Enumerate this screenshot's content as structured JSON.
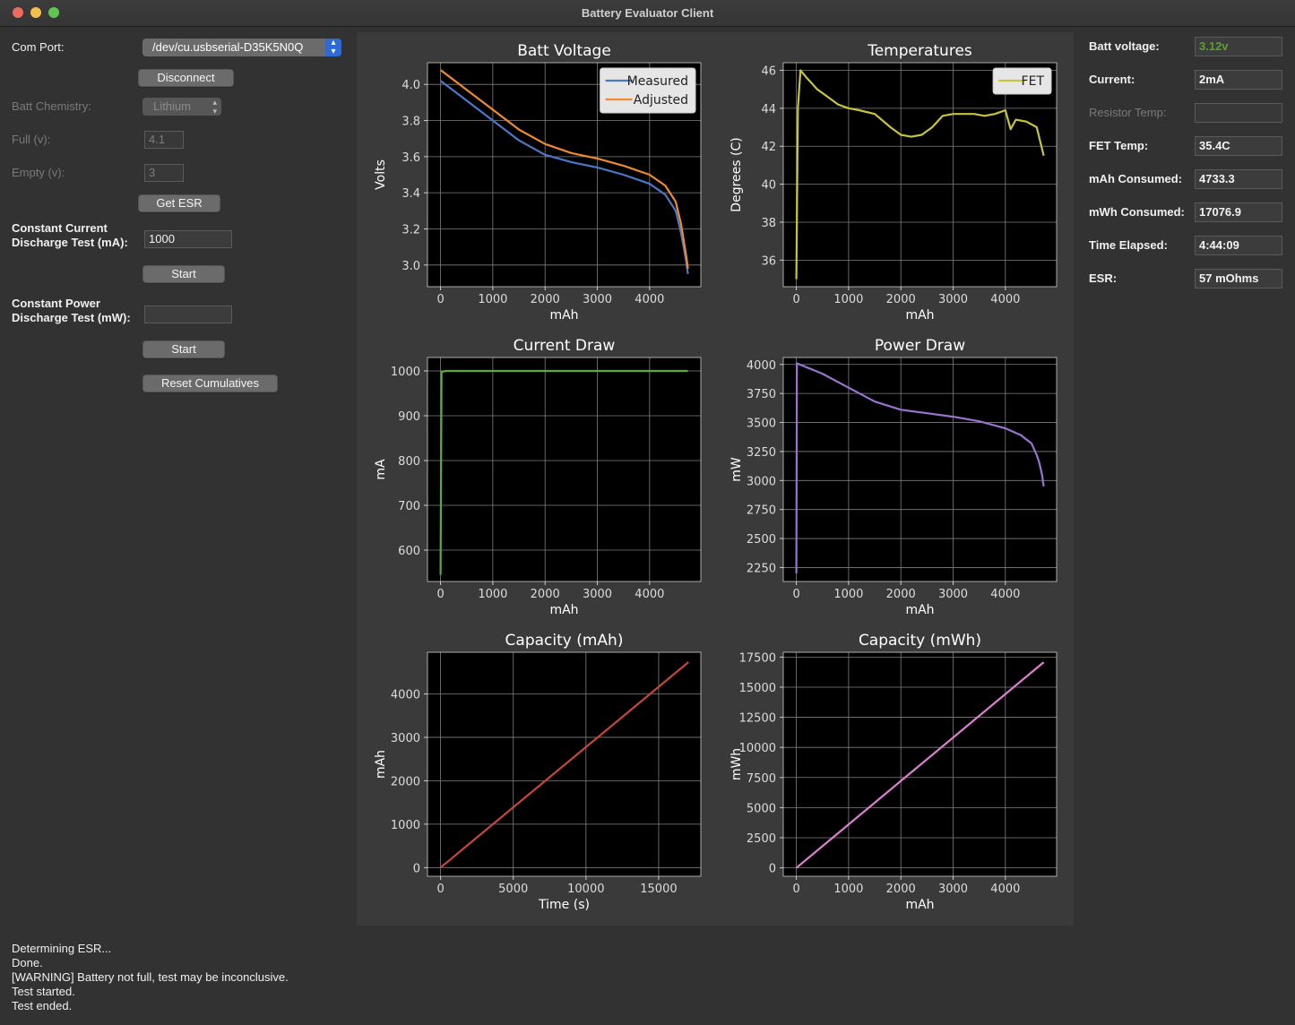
{
  "window": {
    "title": "Battery Evaluator Client"
  },
  "controls": {
    "com_port_label": "Com Port:",
    "com_port_value": "/dev/cu.usbserial-D35K5N0Q",
    "disconnect": "Disconnect",
    "chemistry_label": "Batt Chemistry:",
    "chemistry_value": "Lithium",
    "full_label": "Full (v):",
    "full_value": "4.1",
    "empty_label": "Empty (v):",
    "empty_value": "3",
    "get_esr": "Get ESR",
    "cc_label_1": "Constant Current",
    "cc_label_2": "Discharge Test (mA):",
    "cc_value": "1000",
    "cc_start": "Start",
    "cp_label_1": "Constant Power",
    "cp_label_2": "Discharge Test (mW):",
    "cp_value": "",
    "cp_start": "Start",
    "reset": "Reset Cumulatives"
  },
  "readouts": [
    {
      "label": "Batt voltage:",
      "value": "3.12v",
      "disabled": false,
      "color": "#5aa02c"
    },
    {
      "label": "Current:",
      "value": "2mA",
      "disabled": false
    },
    {
      "label": "Resistor Temp:",
      "value": "",
      "disabled": true
    },
    {
      "label": "FET Temp:",
      "value": "35.4C",
      "disabled": false
    },
    {
      "label": "mAh Consumed:",
      "value": "4733.3",
      "disabled": false
    },
    {
      "label": "mWh Consumed:",
      "value": "17076.9",
      "disabled": false
    },
    {
      "label": "Time Elapsed:",
      "value": "4:44:09",
      "disabled": false
    },
    {
      "label": "ESR:",
      "value": "57 mOhms",
      "disabled": false
    }
  ],
  "status": {
    "lines": [
      "Determining ESR...",
      "Done.",
      "[WARNING] Battery not full, test may be inconclusive.",
      "Test started.",
      "Test ended."
    ]
  },
  "chart_data": [
    {
      "type": "line",
      "title": "Batt Voltage",
      "xlabel": "mAh",
      "ylabel": "Volts",
      "xlim": [
        -250,
        4980
      ],
      "ylim": [
        2.88,
        4.12
      ],
      "xticks": [
        0,
        1000,
        2000,
        3000,
        4000
      ],
      "yticks": [
        3.0,
        3.2,
        3.4,
        3.6,
        3.8,
        4.0
      ],
      "ytick_decimals": 1,
      "grid": true,
      "legend": "top-right",
      "series": [
        {
          "name": "Measured",
          "color": "#4c78c8",
          "x": [
            0,
            500,
            1000,
            1500,
            2000,
            2500,
            3000,
            3500,
            4000,
            4300,
            4500,
            4600,
            4650,
            4700,
            4733
          ],
          "y": [
            4.02,
            3.91,
            3.8,
            3.69,
            3.61,
            3.57,
            3.54,
            3.5,
            3.45,
            3.39,
            3.3,
            3.18,
            3.1,
            3.02,
            2.95
          ]
        },
        {
          "name": "Adjusted",
          "color": "#f08a2c",
          "x": [
            0,
            500,
            1000,
            1500,
            2000,
            2500,
            3000,
            3500,
            4000,
            4300,
            4500,
            4600,
            4650,
            4700,
            4733
          ],
          "y": [
            4.08,
            3.97,
            3.86,
            3.75,
            3.67,
            3.62,
            3.59,
            3.55,
            3.5,
            3.44,
            3.35,
            3.23,
            3.14,
            3.05,
            2.98
          ]
        }
      ]
    },
    {
      "type": "line",
      "title": "Temperatures",
      "xlabel": "mAh",
      "ylabel": "Degrees (C)",
      "xlim": [
        -250,
        4980
      ],
      "ylim": [
        34.6,
        46.4
      ],
      "xticks": [
        0,
        1000,
        2000,
        3000,
        4000
      ],
      "yticks": [
        36,
        38,
        40,
        42,
        44,
        46
      ],
      "ytick_decimals": 0,
      "grid": true,
      "legend": "top-right",
      "series": [
        {
          "name": "FET",
          "color": "#c8c43c",
          "x": [
            0,
            30,
            80,
            200,
            400,
            600,
            800,
            1000,
            1200,
            1500,
            1800,
            2000,
            2200,
            2400,
            2600,
            2800,
            3000,
            3200,
            3400,
            3600,
            3800,
            4000,
            4100,
            4200,
            4400,
            4600,
            4733
          ],
          "y": [
            35.0,
            44.0,
            46.0,
            45.6,
            45.0,
            44.6,
            44.2,
            44.0,
            43.9,
            43.7,
            43.0,
            42.6,
            42.5,
            42.6,
            43.0,
            43.6,
            43.7,
            43.7,
            43.7,
            43.6,
            43.7,
            43.9,
            42.9,
            43.4,
            43.3,
            43.0,
            41.5
          ]
        }
      ]
    },
    {
      "type": "line",
      "title": "Current Draw",
      "xlabel": "mAh",
      "ylabel": "mA",
      "xlim": [
        -250,
        4980
      ],
      "ylim": [
        530,
        1030
      ],
      "xticks": [
        0,
        1000,
        2000,
        3000,
        4000
      ],
      "yticks": [
        600,
        700,
        800,
        900,
        1000
      ],
      "ytick_decimals": 0,
      "grid": true,
      "series": [
        {
          "color": "#5cab38",
          "x": [
            0,
            20,
            100,
            1000,
            2000,
            3000,
            4000,
            4733
          ],
          "y": [
            545,
            998,
            1000,
            1000,
            1000,
            1000,
            1000,
            1000
          ]
        }
      ]
    },
    {
      "type": "line",
      "title": "Power Draw",
      "xlabel": "mAh",
      "ylabel": "mW",
      "xlim": [
        -250,
        4980
      ],
      "ylim": [
        2130,
        4060
      ],
      "xticks": [
        0,
        1000,
        2000,
        3000,
        4000
      ],
      "yticks": [
        2250,
        2500,
        2750,
        3000,
        3250,
        3500,
        3750,
        4000
      ],
      "ytick_decimals": 0,
      "grid": true,
      "series": [
        {
          "color": "#9b72d0",
          "x": [
            0,
            10,
            500,
            1000,
            1500,
            2000,
            2500,
            3000,
            3500,
            4000,
            4300,
            4500,
            4600,
            4650,
            4700,
            4733
          ],
          "y": [
            2200,
            4010,
            3920,
            3800,
            3680,
            3610,
            3580,
            3550,
            3510,
            3450,
            3390,
            3320,
            3220,
            3150,
            3050,
            2950
          ]
        }
      ]
    },
    {
      "type": "line",
      "title": "Capacity (mAh)",
      "xlabel": "Time (s)",
      "ylabel": "mAh",
      "xlim": [
        -900,
        17900
      ],
      "ylim": [
        -200,
        4960
      ],
      "xticks": [
        0,
        5000,
        10000,
        15000
      ],
      "yticks": [
        0,
        1000,
        2000,
        3000,
        4000
      ],
      "ytick_decimals": 0,
      "grid": true,
      "series": [
        {
          "color": "#c8463a",
          "x": [
            0,
            17049
          ],
          "y": [
            0,
            4733
          ]
        }
      ]
    },
    {
      "type": "line",
      "title": "Capacity (mWh)",
      "xlabel": "mAh",
      "ylabel": "mWh",
      "xlim": [
        -250,
        4980
      ],
      "ylim": [
        -700,
        17900
      ],
      "xticks": [
        0,
        1000,
        2000,
        3000,
        4000
      ],
      "yticks": [
        0,
        2500,
        5000,
        7500,
        10000,
        12500,
        15000,
        17500
      ],
      "ytick_decimals": 0,
      "grid": true,
      "series": [
        {
          "color": "#de7fd0",
          "x": [
            0,
            4733
          ],
          "y": [
            0,
            17077
          ]
        }
      ]
    }
  ]
}
